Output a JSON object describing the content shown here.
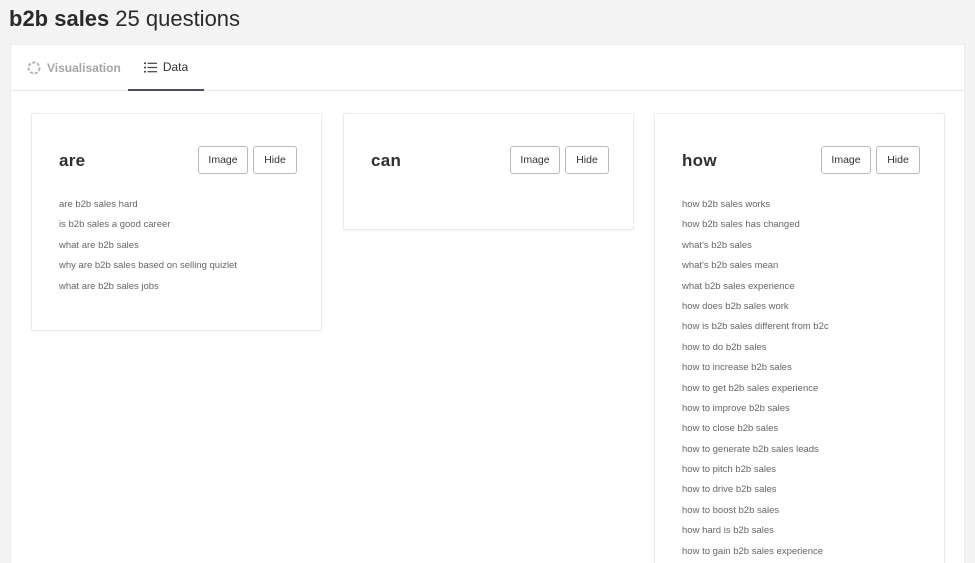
{
  "header": {
    "keyword": "b2b sales",
    "count": "25 questions"
  },
  "tabs": [
    {
      "label": "Visualisation",
      "icon": "spinner-circle-icon",
      "active": false
    },
    {
      "label": "Data",
      "icon": "list-icon",
      "active": true
    }
  ],
  "buttons": {
    "image_label": "Image",
    "hide_label": "Hide"
  },
  "cards": [
    {
      "title": "are",
      "questions": [
        "are b2b sales hard",
        "is b2b sales a good career",
        "what are b2b sales",
        "why are b2b sales based on selling quizlet",
        "what are b2b sales jobs"
      ]
    },
    {
      "title": "can",
      "questions": []
    },
    {
      "title": "how",
      "questions": [
        "how b2b sales works",
        "how b2b sales has changed",
        "what's b2b sales",
        "what's b2b sales mean",
        "what b2b sales experience",
        "how does b2b sales work",
        "how is b2b sales different from b2c",
        "how to do b2b sales",
        "how to increase b2b sales",
        "how to get b2b sales experience",
        "how to improve b2b sales",
        "how to close b2b sales",
        "how to generate b2b sales leads",
        "how to pitch b2b sales",
        "how to drive b2b sales",
        "how to boost b2b sales",
        "how hard is b2b sales",
        "how to gain b2b sales experience"
      ]
    }
  ]
}
